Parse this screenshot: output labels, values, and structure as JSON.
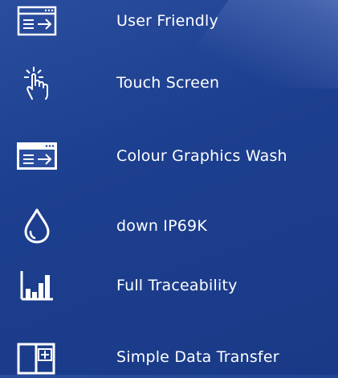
{
  "features": [
    {
      "icon": "screen-arrow-icon",
      "label": "User Friendly"
    },
    {
      "icon": "touch-hand-icon",
      "label": "Touch Screen"
    },
    {
      "icon": "color-screen-icon",
      "label": "Colour Graphics Wash"
    },
    {
      "icon": "water-drop-icon",
      "label": "down IP69K"
    },
    {
      "icon": "bar-chart-icon",
      "label": "Full Traceability"
    },
    {
      "icon": "data-transfer-icon",
      "label": "Simple Data Transfer"
    }
  ],
  "colors": {
    "background": "#1d3f8f",
    "text": "#ffffff"
  }
}
